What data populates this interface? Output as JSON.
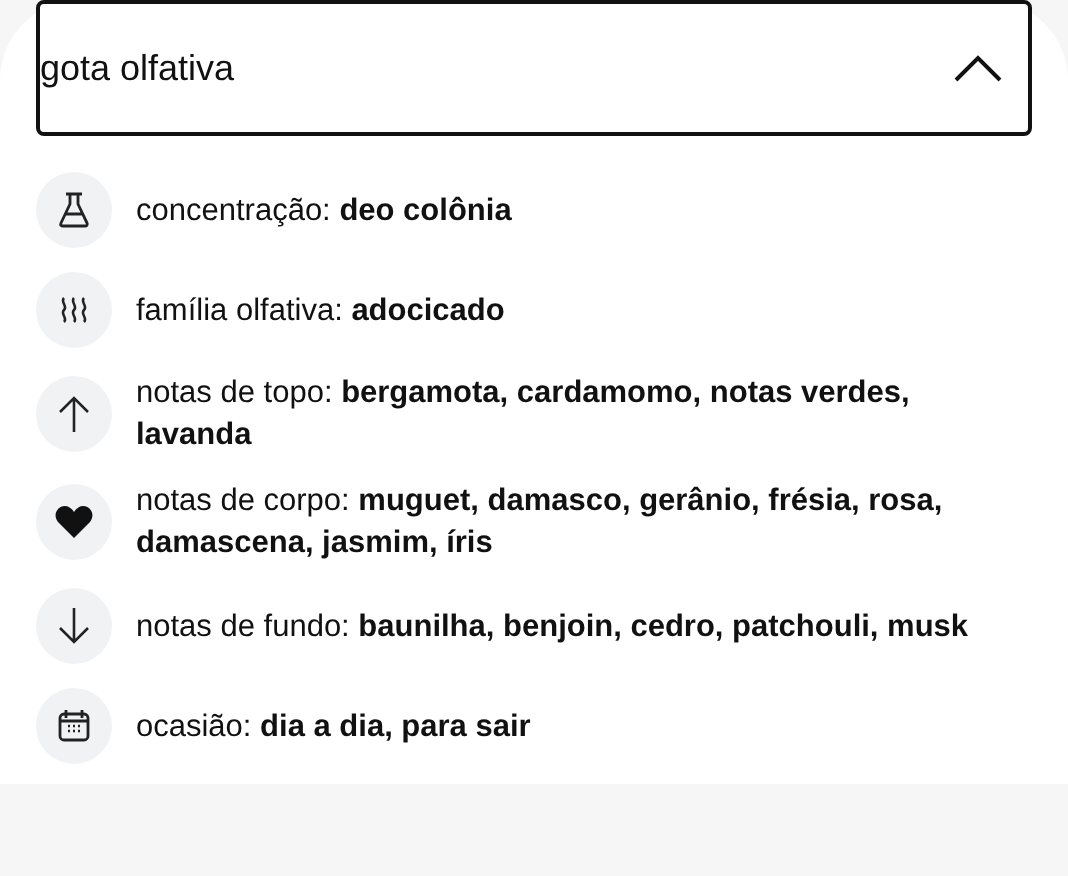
{
  "section": {
    "title": "gota olfativa",
    "expanded": true
  },
  "items": [
    {
      "kind": "flask",
      "text": "concentração: **deo colônia**"
    },
    {
      "kind": "waves",
      "text": "família olfativa: **adocicado**"
    },
    {
      "kind": "up",
      "text": "notas de topo: **bergamota, cardamomo, notas verdes, lavanda**"
    },
    {
      "kind": "heart",
      "text": "notas de corpo: **muguet, damasco, gerânio, frésia, rosa, damascena, jasmim, íris**"
    },
    {
      "kind": "down",
      "text": "notas de fundo: **baunilha, benjoin, cedro, patchouli, musk**"
    },
    {
      "kind": "calendar",
      "text": "ocasião: **dia a dia, para sair**"
    }
  ]
}
